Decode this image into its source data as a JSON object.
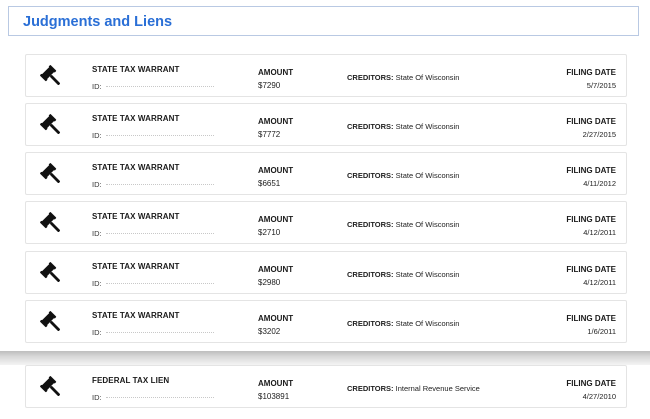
{
  "section": {
    "title": "Judgments and Liens"
  },
  "labels": {
    "id": "ID:",
    "amount": "AMOUNT",
    "creditors": "CREDITORS:",
    "filing_date": "FILING DATE"
  },
  "records": [
    {
      "type": "STATE TAX WARRANT",
      "amount": "$7290",
      "creditor": "State Of Wisconsin",
      "filing_date": "5/7/2015"
    },
    {
      "type": "STATE TAX WARRANT",
      "amount": "$7772",
      "creditor": "State Of Wisconsin",
      "filing_date": "2/27/2015"
    },
    {
      "type": "STATE TAX WARRANT",
      "amount": "$6651",
      "creditor": "State Of Wisconsin",
      "filing_date": "4/11/2012"
    },
    {
      "type": "STATE TAX WARRANT",
      "amount": "$2710",
      "creditor": "State Of Wisconsin",
      "filing_date": "4/12/2011"
    },
    {
      "type": "STATE TAX WARRANT",
      "amount": "$2980",
      "creditor": "State Of Wisconsin",
      "filing_date": "4/12/2011"
    },
    {
      "type": "STATE TAX WARRANT",
      "amount": "$3202",
      "creditor": "State Of Wisconsin",
      "filing_date": "1/6/2011"
    },
    {
      "type": "FEDERAL TAX LIEN",
      "amount": "$103891",
      "creditor": "Internal Revenue Service",
      "filing_date": "4/27/2010"
    }
  ],
  "icons": {
    "record": "gavel-icon"
  },
  "colors": {
    "title": "#2a6fd6",
    "border": "#b9c9e3"
  }
}
